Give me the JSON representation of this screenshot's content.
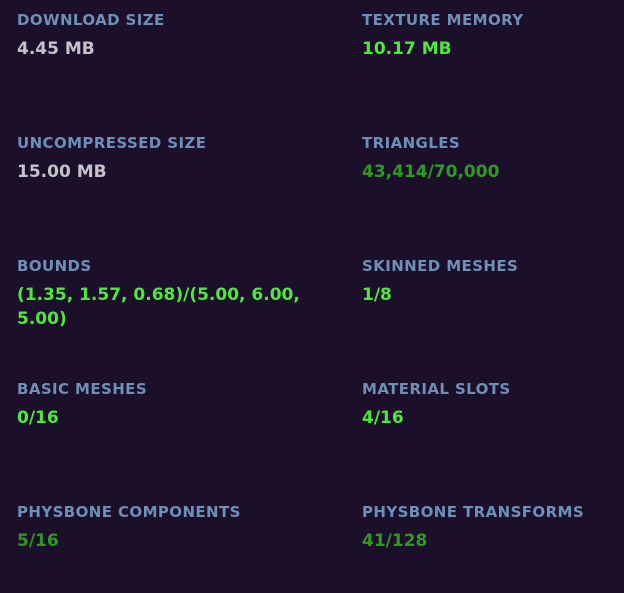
{
  "stats": [
    {
      "label": "DOWNLOAD SIZE",
      "value": "4.45 MB",
      "color": "#c3c3cc"
    },
    {
      "label": "TEXTURE MEMORY",
      "value": "10.17 MB",
      "color": "#4cea3a"
    },
    {
      "label": "UNCOMPRESSED SIZE",
      "value": "15.00 MB",
      "color": "#c3c3cc"
    },
    {
      "label": "TRIANGLES",
      "value": "43,414/70,000",
      "color": "#2f9a22"
    },
    {
      "label": "BOUNDS",
      "value": "(1.35, 1.57, 0.68)/(5.00, 6.00, 5.00)",
      "color": "#4cea3a"
    },
    {
      "label": "SKINNED MESHES",
      "value": "1/8",
      "color": "#4cea3a"
    },
    {
      "label": "BASIC MESHES",
      "value": "0/16",
      "color": "#4cea3a"
    },
    {
      "label": "MATERIAL SLOTS",
      "value": "4/16",
      "color": "#4cea3a"
    },
    {
      "label": "PHYSBONE COMPONENTS",
      "value": "5/16",
      "color": "#2f9a22"
    },
    {
      "label": "PHYSBONE TRANSFORMS",
      "value": "41/128",
      "color": "#2f9a22"
    }
  ]
}
